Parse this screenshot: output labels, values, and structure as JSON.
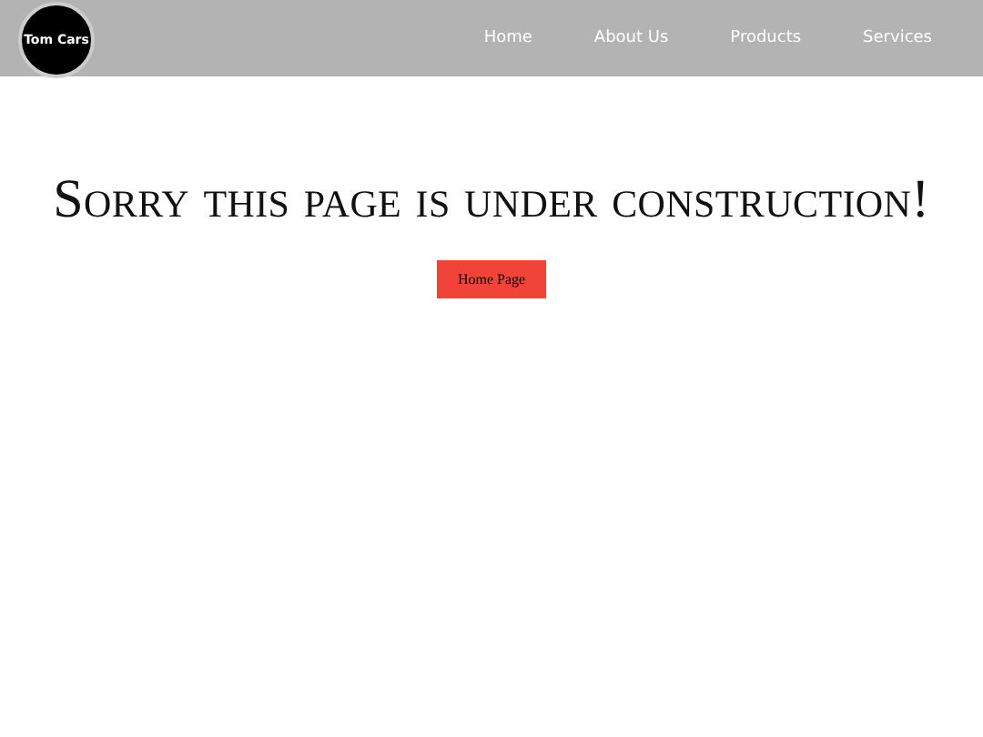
{
  "logo": {
    "text": "Tom Cars"
  },
  "nav": [
    {
      "label": "Home"
    },
    {
      "label": "About Us"
    },
    {
      "label": "Products"
    },
    {
      "label": "Services"
    }
  ],
  "heading": "Sorry this page is under construction!",
  "button": "Home Page"
}
